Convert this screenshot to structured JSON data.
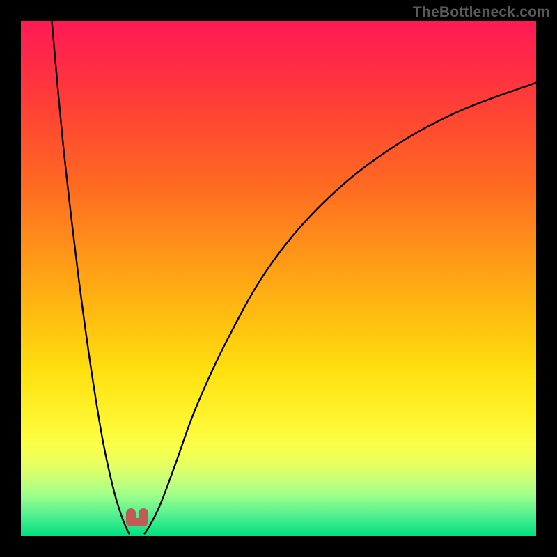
{
  "watermark": "TheBottleneck.com",
  "chart_data": {
    "type": "line",
    "title": "",
    "xlabel": "",
    "ylabel": "",
    "xlim": [
      0,
      100
    ],
    "ylim": [
      0,
      100
    ],
    "grid": false,
    "series": [
      {
        "name": "left-branch",
        "x": [
          6,
          8,
          10,
          12,
          14,
          16,
          18,
          19.5,
          20.5,
          21
        ],
        "values": [
          100,
          78,
          60,
          44,
          30,
          18,
          9,
          4,
          1.5,
          0.5
        ]
      },
      {
        "name": "right-branch",
        "x": [
          24,
          25,
          27,
          30,
          34,
          40,
          48,
          58,
          70,
          84,
          100
        ],
        "values": [
          0.5,
          2,
          6,
          14,
          25,
          38,
          52,
          64,
          74,
          82,
          88
        ]
      }
    ],
    "marker": {
      "x": 22.5,
      "y": 2.2
    },
    "background": {
      "type": "vertical-gradient",
      "stops": [
        {
          "pos": 0,
          "color": "#ff1a55"
        },
        {
          "pos": 18,
          "color": "#ff4433"
        },
        {
          "pos": 45,
          "color": "#ff9518"
        },
        {
          "pos": 68,
          "color": "#ffe010"
        },
        {
          "pos": 82,
          "color": "#fcff45"
        },
        {
          "pos": 92,
          "color": "#a0ff8a"
        },
        {
          "pos": 100,
          "color": "#00e080"
        }
      ]
    }
  }
}
